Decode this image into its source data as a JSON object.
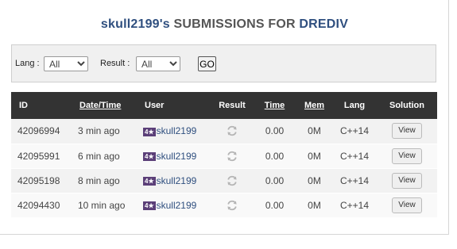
{
  "header": {
    "user_handle": "skull2199's",
    "middle_text": "SUBMISSIONS FOR",
    "problem_code": "DREDIV"
  },
  "filters": {
    "lang_label": "Lang :",
    "lang_value": "All",
    "result_label": "Result :",
    "result_value": "All",
    "go_label": "GO"
  },
  "table": {
    "columns": {
      "id": "ID",
      "date_time": "Date/Time",
      "user": "User",
      "result": "Result",
      "time": "Time",
      "mem": "Mem",
      "lang": "Lang",
      "solution": "Solution"
    },
    "rows": [
      {
        "id": "42096994",
        "when": "3 min ago",
        "stars": "4★",
        "user": "skull2199",
        "result_icon": "refresh-icon",
        "time": "0.00",
        "mem": "0M",
        "lang": "C++14",
        "action": "View"
      },
      {
        "id": "42095991",
        "when": "6 min ago",
        "stars": "4★",
        "user": "skull2199",
        "result_icon": "refresh-icon",
        "time": "0.00",
        "mem": "0M",
        "lang": "C++14",
        "action": "View"
      },
      {
        "id": "42095198",
        "when": "8 min ago",
        "stars": "4★",
        "user": "skull2199",
        "result_icon": "refresh-icon",
        "time": "0.00",
        "mem": "0M",
        "lang": "C++14",
        "action": "View"
      },
      {
        "id": "42094430",
        "when": "10 min ago",
        "stars": "4★",
        "user": "skull2199",
        "result_icon": "refresh-icon",
        "time": "0.00",
        "mem": "0M",
        "lang": "C++14",
        "action": "View"
      }
    ]
  },
  "colors": {
    "header_bg": "#333333",
    "link": "#2f4f7f",
    "star_badge": "#5b3f78"
  }
}
